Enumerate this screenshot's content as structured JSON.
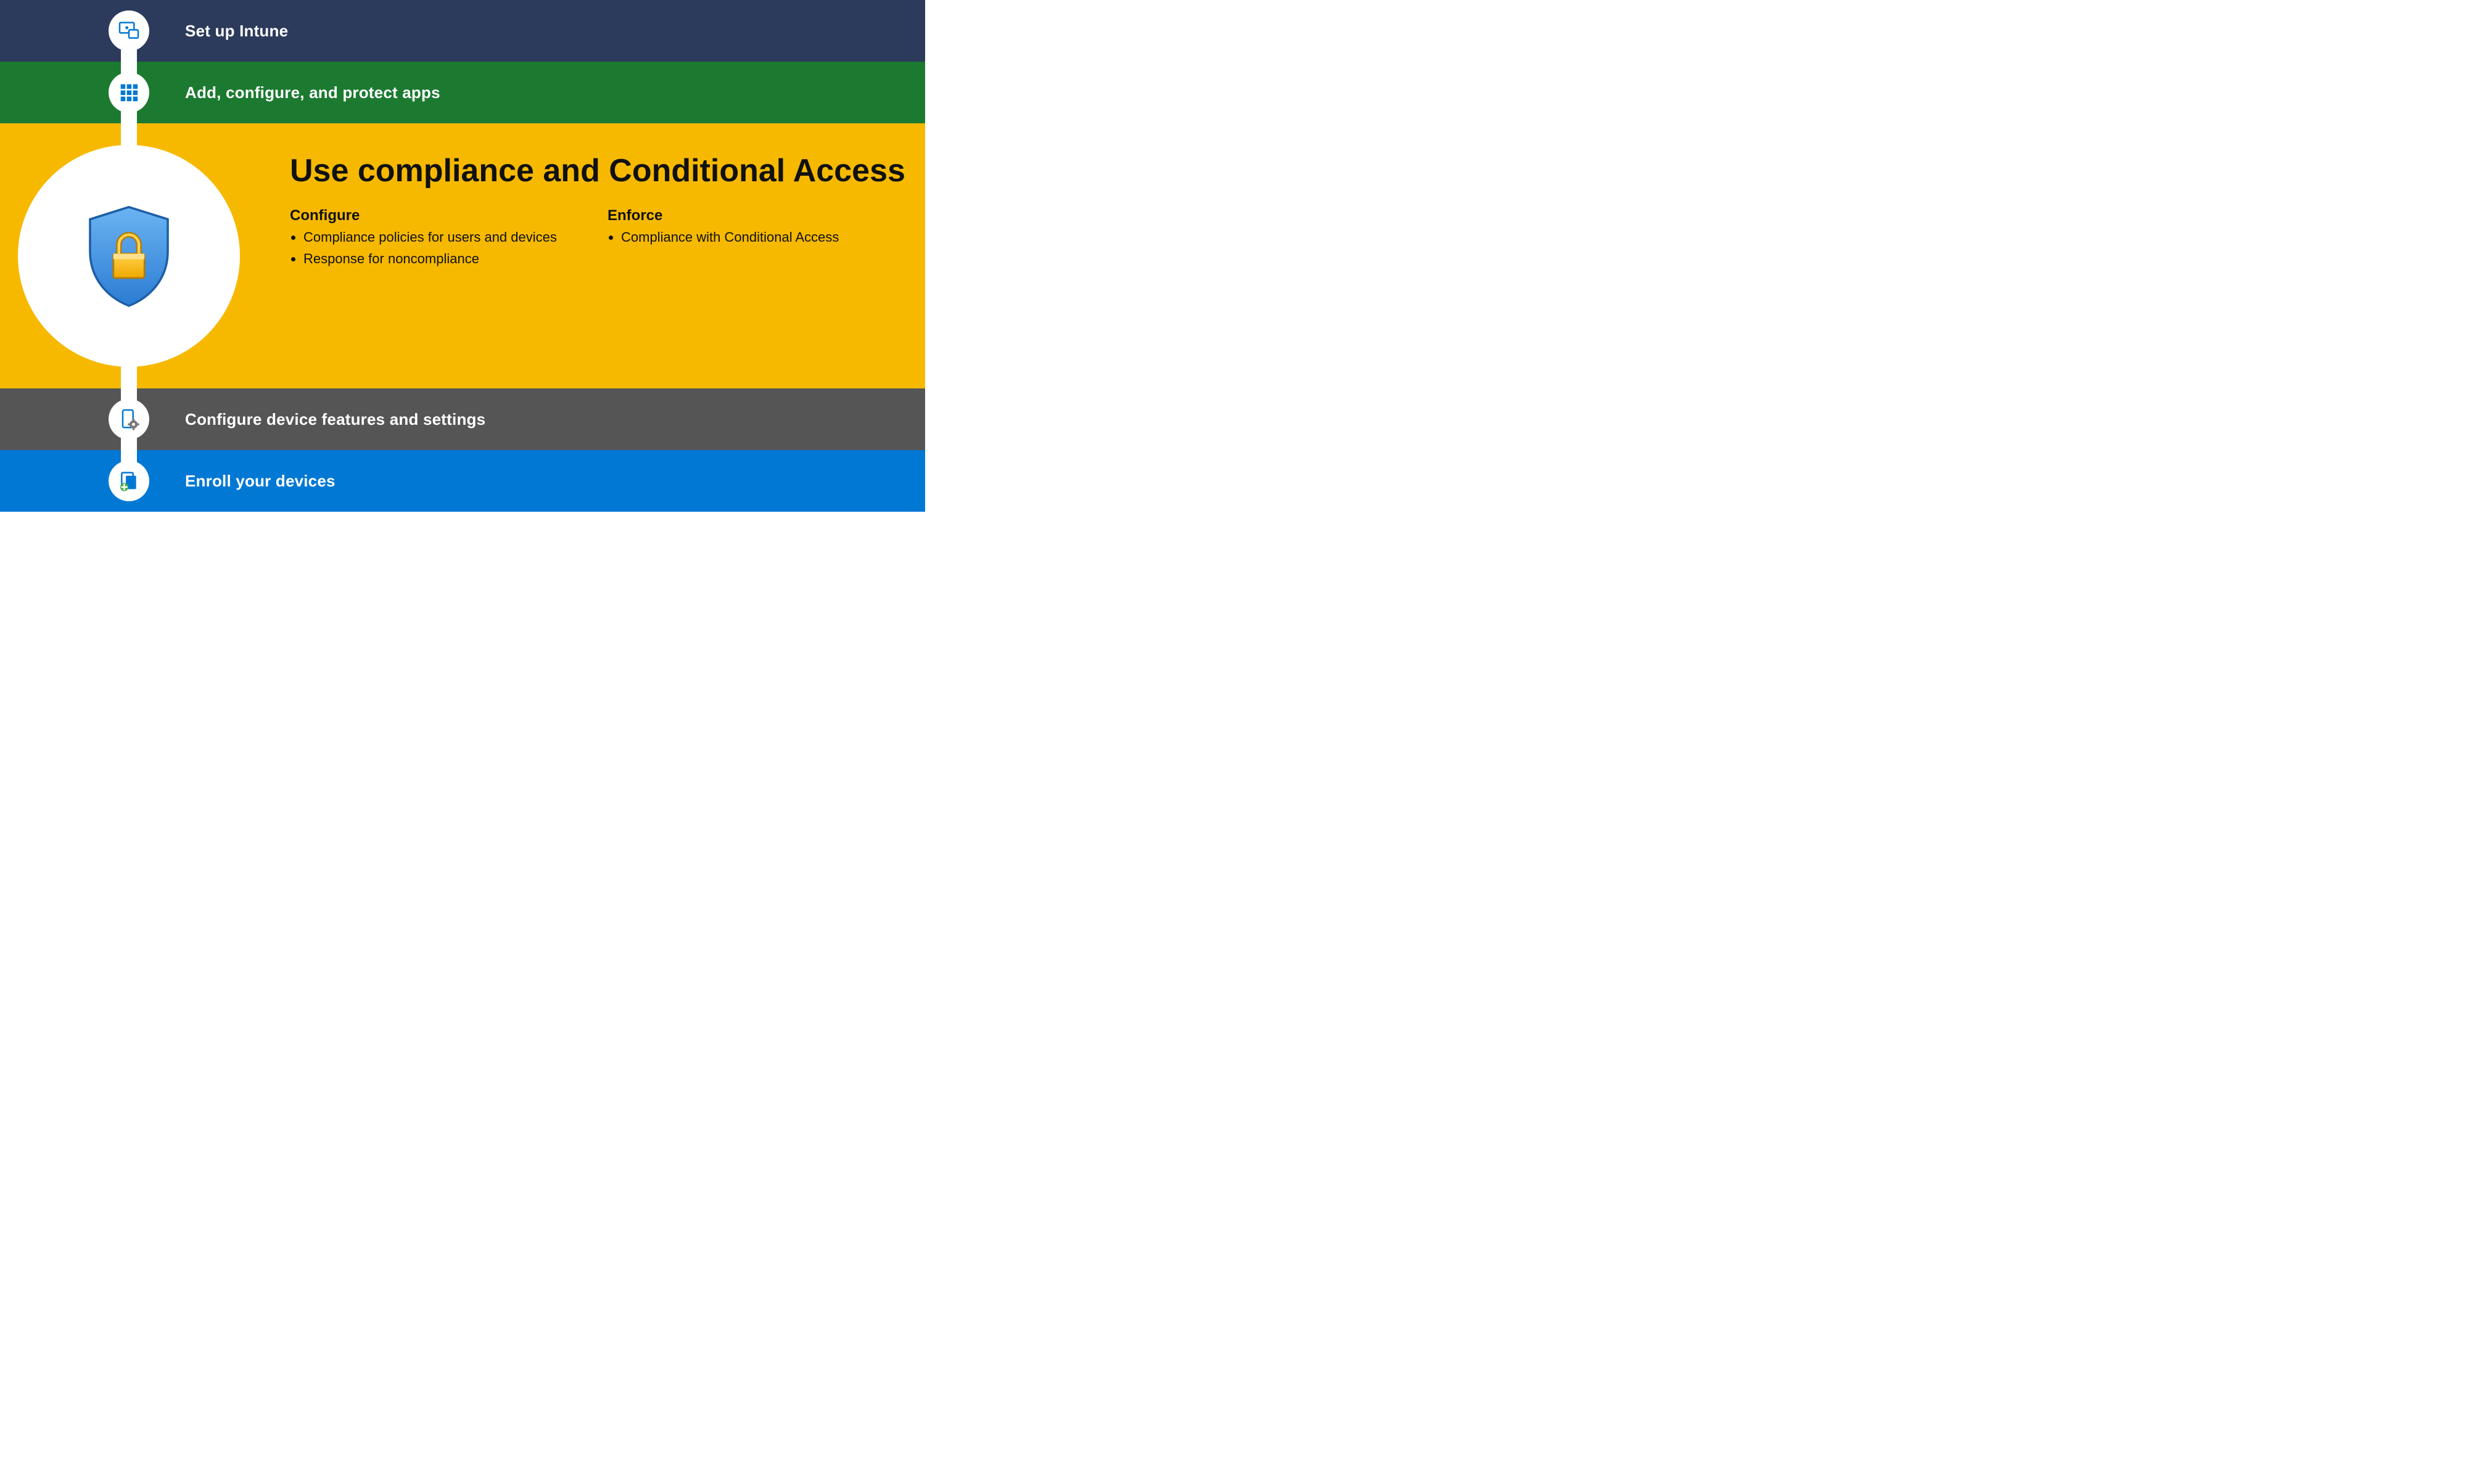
{
  "steps": {
    "setup": {
      "label": "Set up Intune"
    },
    "apps": {
      "label": "Add, configure, and protect apps"
    },
    "devconf": {
      "label": "Configure device features and settings"
    },
    "enroll": {
      "label": "Enroll your devices"
    }
  },
  "active": {
    "title": "Use compliance and Conditional Access",
    "columns": {
      "configure": {
        "heading": "Configure",
        "items": [
          "Compliance policies for users and devices",
          "Response for noncompliance"
        ]
      },
      "enforce": {
        "heading": "Enforce",
        "items": [
          "Compliance with Conditional Access"
        ]
      }
    }
  },
  "colors": {
    "navy": "#2c3a5c",
    "green": "#1b7a30",
    "amber": "#f6b900",
    "grey": "#555555",
    "blue": "#0078d4"
  }
}
